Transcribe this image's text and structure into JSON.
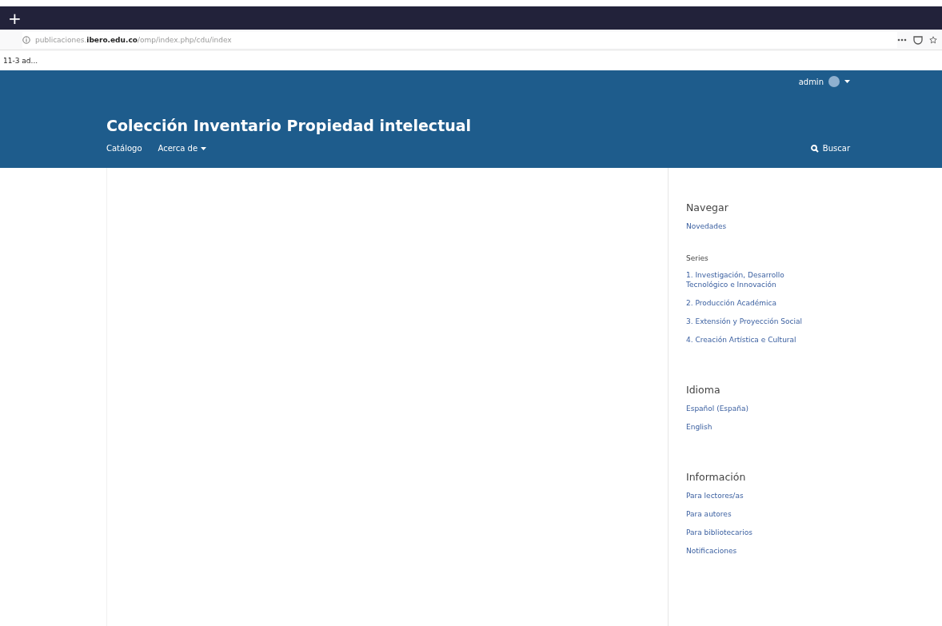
{
  "browser": {
    "new_tab": "+",
    "url": "publicaciones.**ibero.edu.co**/omp/index.php/cdu/index",
    "bookmark": "11-3 ad..."
  },
  "header": {
    "user": "admin",
    "title": "Colección Inventario Propiedad intelectual",
    "nav": [
      {
        "label": "Catálogo",
        "dropdown": false
      },
      {
        "label": "Acerca de",
        "dropdown": true
      }
    ],
    "search": "Buscar"
  },
  "sidebar": [
    {
      "title": "Navegar",
      "groups": [
        {
          "links": [
            "Novedades"
          ]
        },
        {
          "heading": "Series",
          "links": [
            "1. Investigación, Desarrollo Tecnológico e Innovación",
            "2. Producción Académica",
            "3. Extensión y Proyección Social",
            "4. Creación Artística e Cultural"
          ]
        }
      ]
    },
    {
      "title": "Idioma",
      "groups": [
        {
          "links": [
            "Español (España)",
            "English"
          ]
        }
      ]
    },
    {
      "title": "Información",
      "groups": [
        {
          "links": [
            "Para lectores/as",
            "Para autores",
            "Para bibliotecarios",
            "Notificaciones"
          ]
        }
      ]
    }
  ]
}
